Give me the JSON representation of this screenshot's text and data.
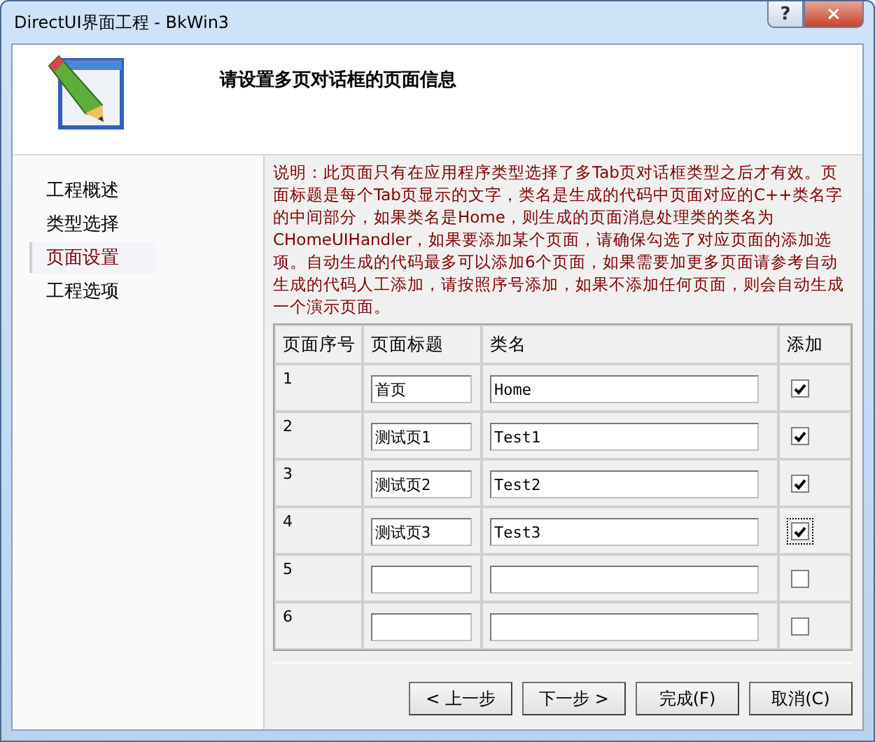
{
  "window": {
    "title": "DirectUI界面工程 - BkWin3",
    "help": "?",
    "close": "×"
  },
  "header": {
    "heading": "请设置多页对话框的页面信息"
  },
  "sidebar": {
    "items": [
      {
        "label": "工程概述",
        "selected": false
      },
      {
        "label": "类型选择",
        "selected": false
      },
      {
        "label": "页面设置",
        "selected": true
      },
      {
        "label": "工程选项",
        "selected": false
      }
    ]
  },
  "description": "说明：此页面只有在应用程序类型选择了多Tab页对话框类型之后才有效。页面标题是每个Tab页显示的文字，类名是生成的代码中页面对应的C++类名字的中间部分，如果类名是Home，则生成的页面消息处理类的类名为CHomeUIHandler，如果要添加某个页面，请确保勾选了对应页面的添加选项。自动生成的代码最多可以添加6个页面，如果需要加更多页面请参考自动生成的代码人工添加，请按照序号添加，如果不添加任何页面，则会自动生成一个演示页面。",
  "table": {
    "columns": [
      "页面序号",
      "页面标题",
      "类名",
      "添加"
    ],
    "rows": [
      {
        "number": "1",
        "title": "首页",
        "class_name": "Home",
        "checked": true,
        "focused": false
      },
      {
        "number": "2",
        "title": "测试页1",
        "class_name": "Test1",
        "checked": true,
        "focused": false
      },
      {
        "number": "3",
        "title": "测试页2",
        "class_name": "Test2",
        "checked": true,
        "focused": false
      },
      {
        "number": "4",
        "title": "测试页3",
        "class_name": "Test3",
        "checked": true,
        "focused": true
      },
      {
        "number": "5",
        "checked": false,
        "focused": false
      },
      {
        "number": "6",
        "checked": false,
        "focused": false
      }
    ]
  },
  "buttons": [
    "< 上一步",
    "下一步 >",
    "完成(F)",
    "取消(C)"
  ]
}
